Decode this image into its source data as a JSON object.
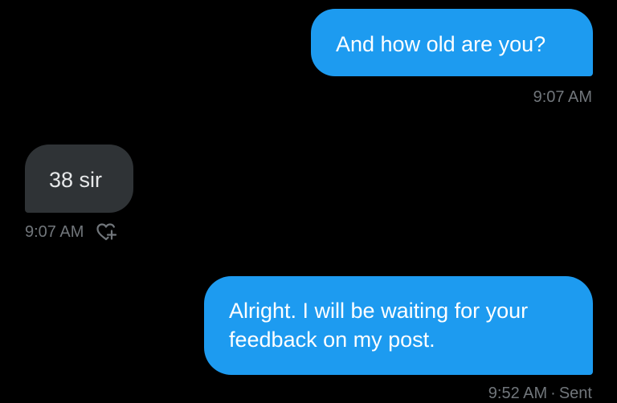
{
  "conversation": {
    "messages": [
      {
        "direction": "sent",
        "lines": [
          "And how old are you?"
        ],
        "time": "9:07 AM"
      },
      {
        "direction": "received",
        "lines": [
          "38 sir"
        ],
        "time": "9:07 AM",
        "reaction_icon": "add-reaction-heart-icon"
      },
      {
        "direction": "sent",
        "lines": [
          "Alright. I will be waiting for your",
          "feedback on my post."
        ],
        "time": "9:52 AM",
        "status": "Sent"
      }
    ]
  },
  "colors": {
    "background": "#000000",
    "sent_bubble": "#1d9bf0",
    "received_bubble": "#2f3336",
    "timestamp": "#71767b"
  }
}
